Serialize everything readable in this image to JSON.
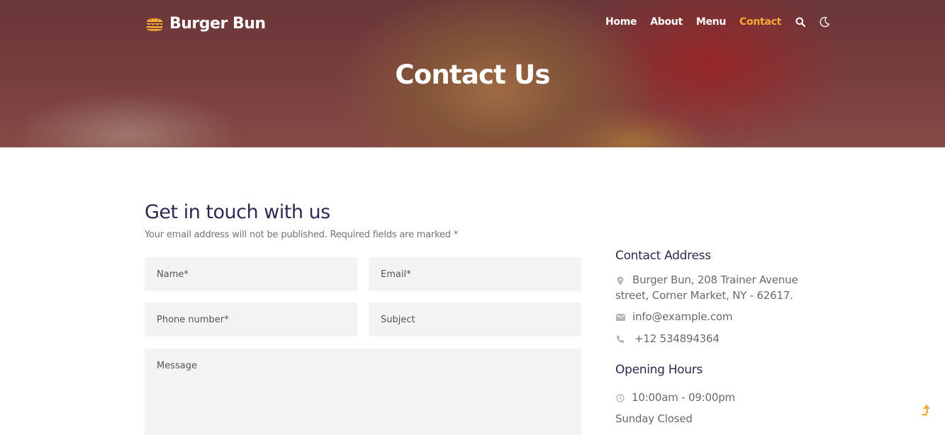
{
  "brand": {
    "name": "Burger Bun",
    "icon": "burger-icon"
  },
  "nav": {
    "items": [
      {
        "label": "Home",
        "active": false
      },
      {
        "label": "About",
        "active": false
      },
      {
        "label": "Menu",
        "active": false
      },
      {
        "label": "Contact",
        "active": true
      }
    ],
    "search_icon": "search-icon",
    "theme_icon": "moon-icon"
  },
  "hero": {
    "title": "Contact Us"
  },
  "form": {
    "title": "Get in touch with us",
    "note": "Your email address will not be published. Required fields are marked *",
    "fields": {
      "name": {
        "placeholder": "Name*",
        "value": ""
      },
      "email": {
        "placeholder": "Email*",
        "value": ""
      },
      "phone": {
        "placeholder": "Phone number*",
        "value": ""
      },
      "subject": {
        "placeholder": "Subject",
        "value": ""
      },
      "message": {
        "placeholder": "Message",
        "value": ""
      }
    }
  },
  "contact": {
    "heading": "Contact Address",
    "address_line1": "Burger Bun, 208 Trainer Avenue",
    "address_line2": "street, Corner Market, NY - 62617.",
    "email": "info@example.com",
    "phone": "+12 534894364",
    "icons": [
      "map-pin-icon",
      "envelope-icon",
      "phone-icon"
    ]
  },
  "hours": {
    "heading": "Opening Hours",
    "time": "10:00am - 09:00pm",
    "closed": "Sunday Closed",
    "icon": "clock-icon"
  },
  "colors": {
    "accent": "#f5ab35",
    "heading": "#2c2a52",
    "field_bg": "#f3f3f3"
  },
  "scroll_top_icon": "arrow-up-icon"
}
